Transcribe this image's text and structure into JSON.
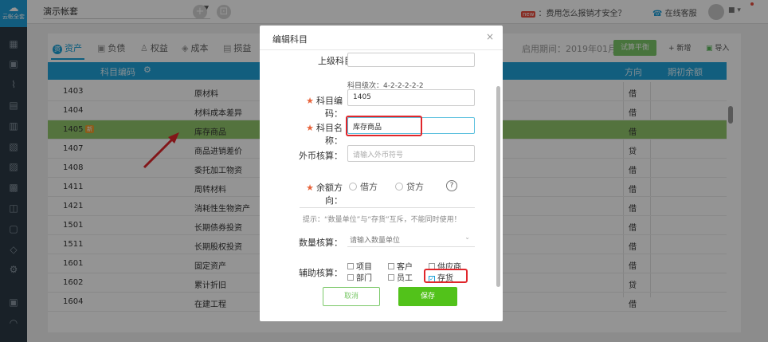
{
  "sidebar": {
    "logo_text": "云帐全套",
    "icons": [
      "grid-icon",
      "voucher-icon",
      "chart-icon",
      "book-icon",
      "report-icon",
      "ledger-icon",
      "table-icon",
      "archive-icon",
      "cart-icon",
      "tax-icon",
      "shield-icon",
      "settings-icon",
      "exit-icon",
      "help-icon"
    ]
  },
  "topbar": {
    "account_name": "演示帐套",
    "question_text": "：费用怎么报销才安全？",
    "question_badge": "new",
    "service_text": "在线客服"
  },
  "tabs": [
    {
      "label": "资产",
      "icon": "资"
    },
    {
      "label": "负债"
    },
    {
      "label": "权益"
    },
    {
      "label": "成本"
    },
    {
      "label": "损益"
    }
  ],
  "toolbar": {
    "period_label": "启用期间：2019年01月",
    "balance_button": "试算平衡",
    "add_button": "+ 新增",
    "import_button": "导入"
  },
  "table": {
    "headers": {
      "code": "科目编码",
      "direction": "方向",
      "opening": "期初余额"
    },
    "rows": [
      {
        "code": "1403",
        "name": "原材料",
        "dir": "借"
      },
      {
        "code": "1404",
        "name": "材料成本差异",
        "dir": "借"
      },
      {
        "code": "1405",
        "name": "库存商品",
        "dir": "借",
        "tag": "新",
        "highlight": true
      },
      {
        "code": "1407",
        "name": "商品进销差价",
        "dir": "贷"
      },
      {
        "code": "1408",
        "name": "委托加工物资",
        "dir": "借"
      },
      {
        "code": "1411",
        "name": "周转材料",
        "dir": "借"
      },
      {
        "code": "1421",
        "name": "消耗性生物资产",
        "dir": "借"
      },
      {
        "code": "1501",
        "name": "长期债券投资",
        "dir": "借"
      },
      {
        "code": "1511",
        "name": "长期股权投资",
        "dir": "借"
      },
      {
        "code": "1601",
        "name": "固定资产",
        "dir": "借"
      },
      {
        "code": "1602",
        "name": "累计折旧",
        "dir": "贷"
      },
      {
        "code": "1604",
        "name": "在建工程",
        "dir": "借"
      }
    ]
  },
  "modal": {
    "title": "编辑科目",
    "close": "×",
    "parent_label": "上级科目：",
    "parent_value": "",
    "level_hint": "科目级次：4-2-2-2-2-2",
    "code_label": "科目编码：",
    "code_value": "1405",
    "name_label": "科目名称：",
    "name_value": "库存商品",
    "currency_label": "外币核算：",
    "currency_placeholder": "请输入外币符号",
    "direction_label": "余额方向：",
    "direction_debit": "借方",
    "direction_credit": "贷方",
    "help": "?",
    "tip": "提示：“数量单位”与“存货”互斥，不能同时使用！",
    "quantity_label": "数量核算：",
    "quantity_placeholder": "请输入数量单位",
    "aux_label": "辅助核算：",
    "aux_options": [
      {
        "label": "项目",
        "checked": false
      },
      {
        "label": "客户",
        "checked": false
      },
      {
        "label": "供应商",
        "checked": false
      },
      {
        "label": "部门",
        "checked": false
      },
      {
        "label": "员工",
        "checked": false
      },
      {
        "label": "存货",
        "checked": true
      }
    ],
    "cancel_button": "取消",
    "save_button": "保存"
  }
}
